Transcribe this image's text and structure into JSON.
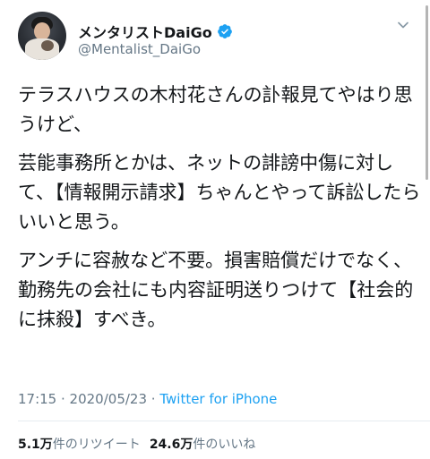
{
  "user": {
    "display_name": "メンタリストDaiGo",
    "handle": "@Mentalist_DaiGo",
    "verified": true,
    "avatar_icon": "profile-photo-with-cat"
  },
  "tweet": {
    "paragraphs": [
      "テラスハウスの木村花さんの訃報見てやはり思うけど、",
      "芸能事務所とかは、ネットの誹謗中傷に対して、【情報開示請求】ちゃんとやって訴訟したらいいと思う。",
      "アンチに容赦など不要。損害賠償だけでなく、勤務先の会社にも内容証明送りつけて【社会的に抹殺】すべき。"
    ]
  },
  "meta": {
    "time": "17:15",
    "separator": " · ",
    "date": "2020/05/23",
    "source": "Twitter for iPhone"
  },
  "stats": {
    "retweets_count": "5.1万",
    "retweets_label": "件のリツイート",
    "likes_count": "24.6万",
    "likes_label": "件のいいね"
  },
  "colors": {
    "text": "#14171a",
    "secondary": "#657786",
    "accent": "#1da1f2",
    "divider": "#e6ecf0"
  },
  "icons": {
    "verified": "verified-badge-icon",
    "menu": "chevron-down-icon"
  }
}
